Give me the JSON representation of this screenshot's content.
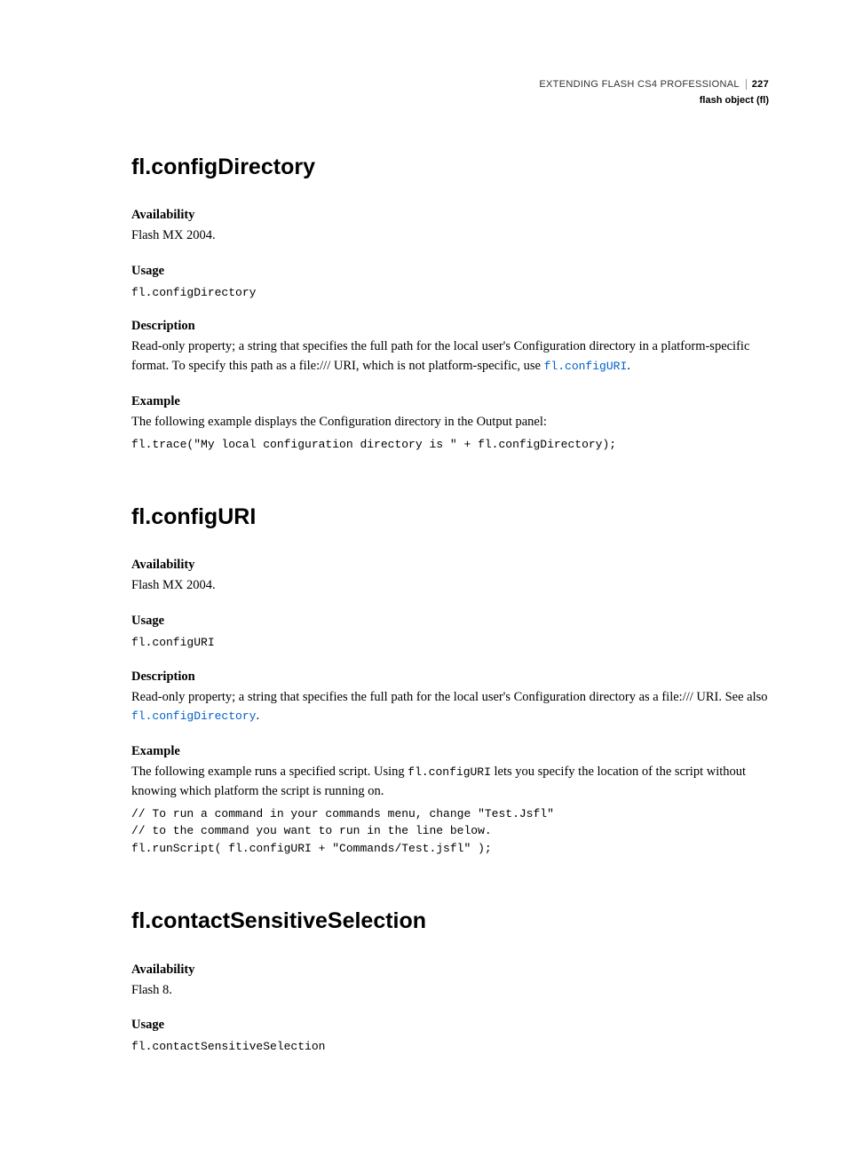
{
  "header": {
    "book": "EXTENDING FLASH CS4 PROFESSIONAL",
    "pagenum": "227",
    "chapter": "flash object (fl)"
  },
  "sections": [
    {
      "title": "fl.configDirectory",
      "availability": {
        "label": "Availability",
        "text": "Flash MX 2004."
      },
      "usage": {
        "label": "Usage",
        "code": "fl.configDirectory"
      },
      "description": {
        "label": "Description",
        "text_before": "Read-only property; a string that specifies the full path for the local user's Configuration directory in a platform-specific format. To specify this path as a file:/// URI, which is not platform-specific, use ",
        "link": "fl.configURI",
        "text_after": "."
      },
      "example": {
        "label": "Example",
        "text": "The following example displays the Configuration directory in the Output panel:",
        "code": "fl.trace(\"My local configuration directory is \" + fl.configDirectory);"
      }
    },
    {
      "title": "fl.configURI",
      "availability": {
        "label": "Availability",
        "text": "Flash MX 2004."
      },
      "usage": {
        "label": "Usage",
        "code": "fl.configURI"
      },
      "description": {
        "label": "Description",
        "text_before": "Read-only property; a string that specifies the full path for the local user's Configuration directory as a file:/// URI. See also ",
        "link": "fl.configDirectory",
        "text_after": "."
      },
      "example": {
        "label": "Example",
        "text_before": "The following example runs a specified script. Using ",
        "inline_code": "fl.configURI",
        "text_after": " lets you specify the location of the script without knowing which platform the script is running on.",
        "code": "// To run a command in your commands menu, change \"Test.Jsfl\"\n// to the command you want to run in the line below.\nfl.runScript( fl.configURI + \"Commands/Test.jsfl\" );"
      }
    },
    {
      "title": "fl.contactSensitiveSelection",
      "availability": {
        "label": "Availability",
        "text": "Flash 8."
      },
      "usage": {
        "label": "Usage",
        "code": "fl.contactSensitiveSelection"
      }
    }
  ]
}
